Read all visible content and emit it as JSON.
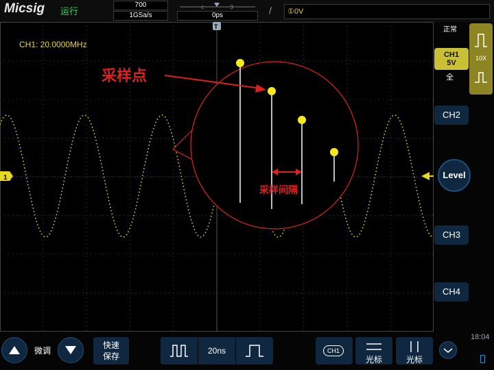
{
  "header": {
    "logo": "Micsig",
    "run_status": "运行",
    "memory_depth": "700",
    "sample_rate": "1GSa/s",
    "trigger_position": "0ps",
    "trigger_slope_icon": "rising-slope-icon",
    "trigger_info": "①0V"
  },
  "screen": {
    "channel_info": "CH1: 20.0000MHz",
    "channel_marker": "1",
    "annotation_sample_point": "采样点",
    "annotation_sample_interval": "采样间隔",
    "trigger_marker": "T",
    "colors": {
      "waveform": "#e8d820",
      "annotation": "#e02020",
      "sample_dot": "#f5ea1a",
      "grid": "#3a3a3a"
    }
  },
  "right_panel": {
    "coupling_mode": "正常",
    "ch1_label": "CH1",
    "ch1_scale": "5V",
    "bandwidth": "全",
    "probe_ratio": "10X",
    "ch2_label": "CH2",
    "level_label": "Level",
    "ch3_label": "CH3",
    "ch4_label": "CH4"
  },
  "bottom_bar": {
    "fine_adjust": "微调",
    "quick_save": "快速\n保存",
    "timebase": "20ns",
    "ch1_chip": "CH1",
    "cursor_h_label": "光标",
    "cursor_v_label": "光标",
    "clock": "18:04"
  }
}
